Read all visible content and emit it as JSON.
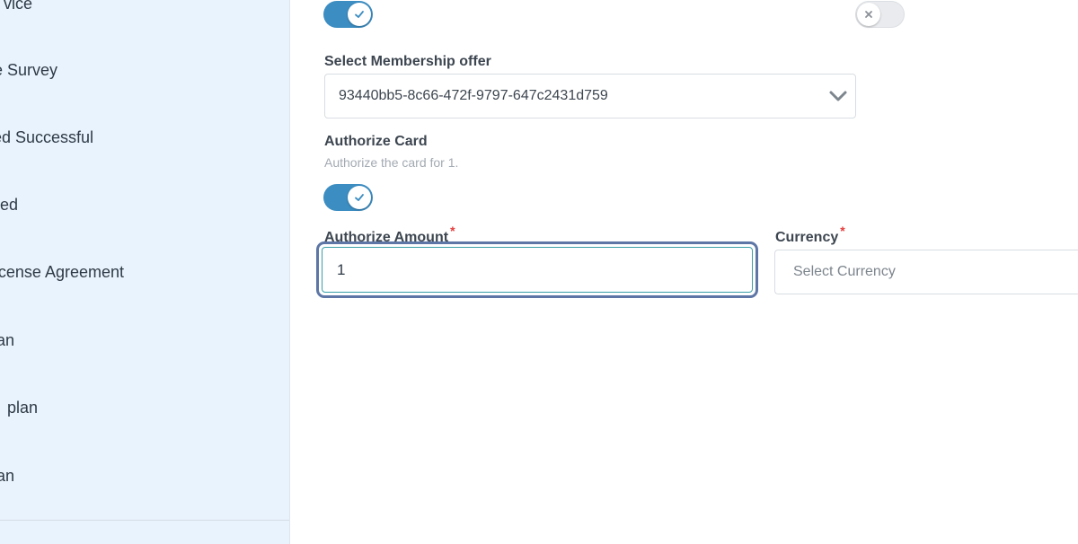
{
  "sidebar": {
    "items": [
      {
        "label": "vice"
      },
      {
        "label": "e Survey"
      },
      {
        "label": "ed Successful"
      },
      {
        "label": "ed"
      },
      {
        "label": "cense Agreement"
      },
      {
        "label": "an"
      },
      {
        "label": "plan"
      },
      {
        "label": "an"
      }
    ]
  },
  "form": {
    "top_toggle_left": {
      "state": "on",
      "icon": "check-icon"
    },
    "top_toggle_right": {
      "state": "off",
      "icon": "x-icon"
    },
    "membership_offer": {
      "label": "Select Membership offer",
      "value": "93440bb5-8c66-472f-9797-647c2431d759"
    },
    "authorize_card": {
      "label": "Authorize Card",
      "helper": "Authorize the card for 1.",
      "toggle_state": "on"
    },
    "authorize_amount": {
      "label": "Authorize Amount",
      "required_mark": "*",
      "value": "1"
    },
    "currency": {
      "label": "Currency",
      "required_mark": "*",
      "placeholder": "Select Currency"
    }
  },
  "colors": {
    "sidebar_bg": "#e9f3fd",
    "toggle_on": "#3c8dc2",
    "toggle_off": "#e9ebee",
    "focus_ring": "#5d76a5",
    "required": "#e43b3b"
  }
}
